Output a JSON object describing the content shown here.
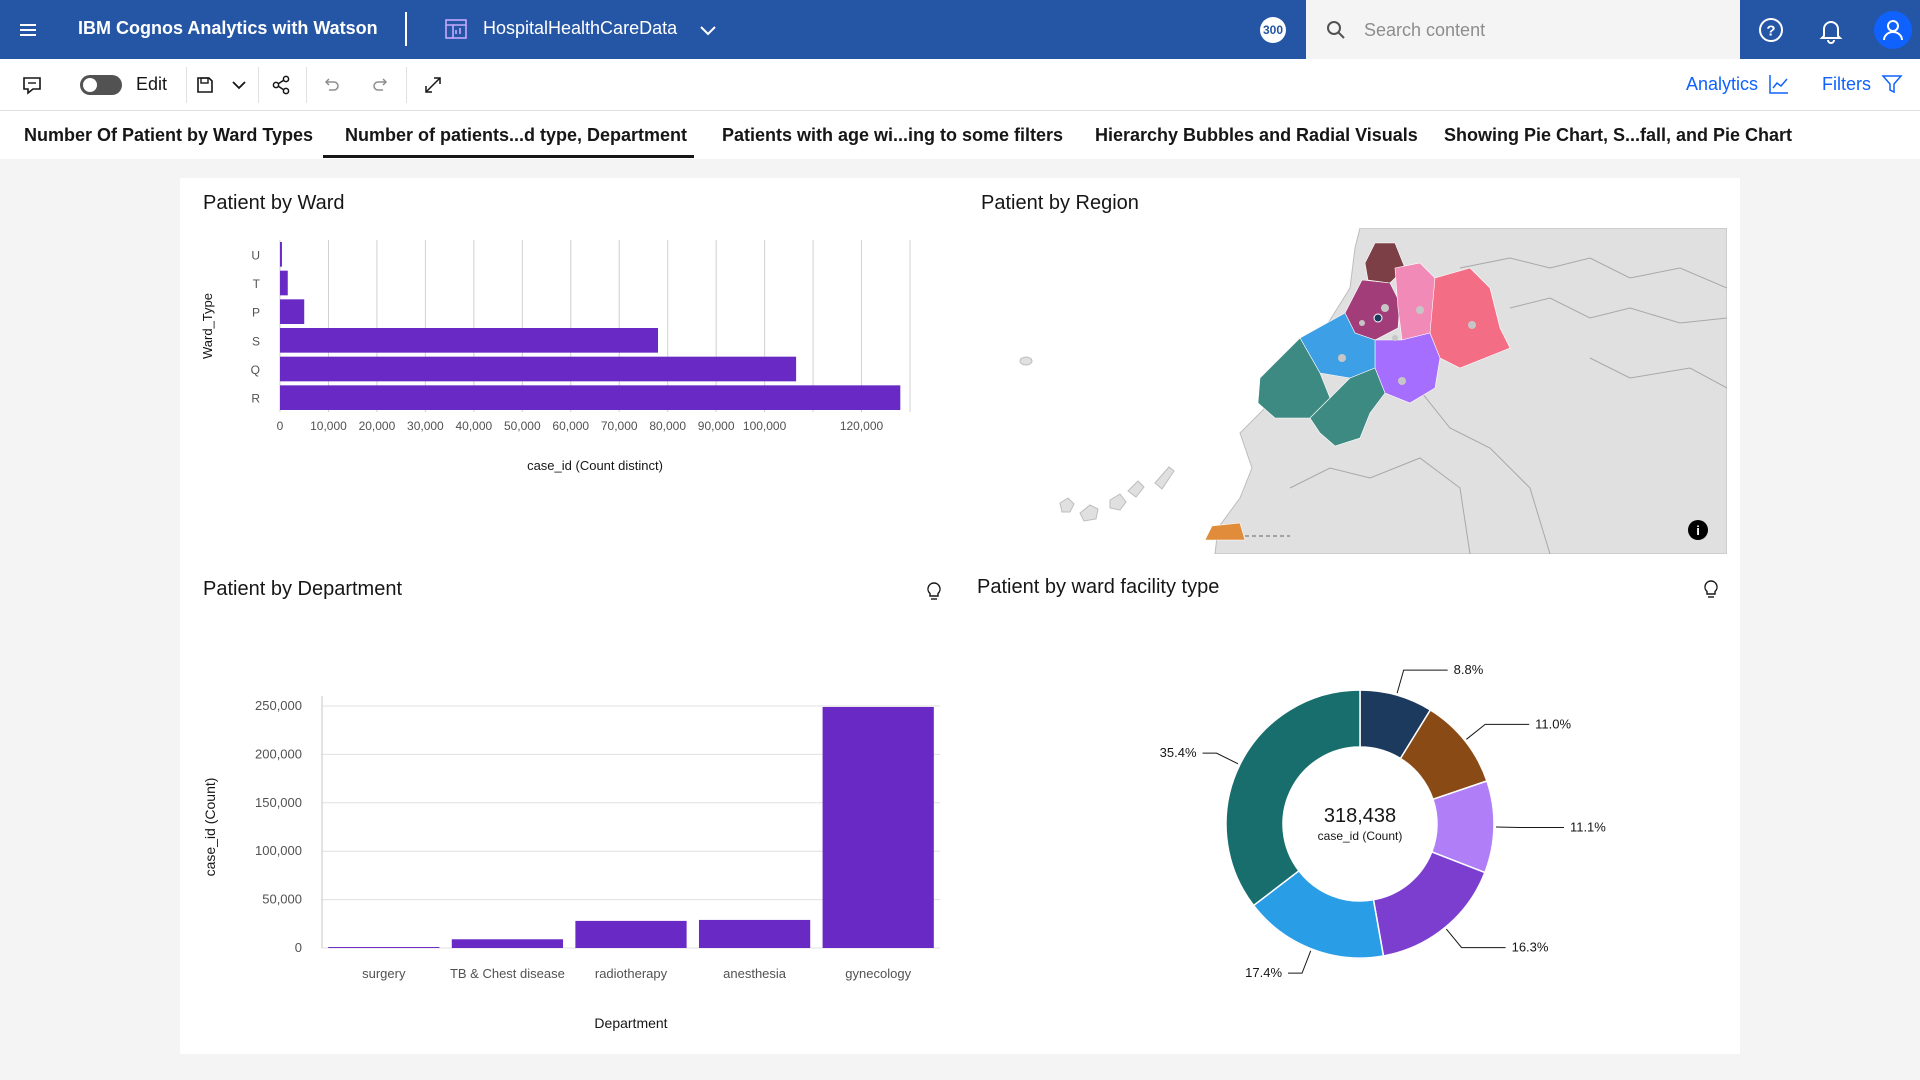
{
  "header": {
    "app_title": "IBM Cognos Analytics with Watson",
    "report_name": "HospitalHealthCareData",
    "counter_badge": "300",
    "search_placeholder": "Search content"
  },
  "toolbar": {
    "edit_label": "Edit",
    "analytics_label": "Analytics",
    "filters_label": "Filters"
  },
  "tabs": [
    {
      "label": "Number Of Patient by Ward Types"
    },
    {
      "label": "Number of patients...d type, Department",
      "active": true
    },
    {
      "label": "Patients with age wi...ing to some filters"
    },
    {
      "label": "Hierarchy Bubbles and Radial Visuals"
    },
    {
      "label": "Showing Pie Chart, S...fall, and Pie Chart"
    }
  ],
  "widgets": {
    "ward": {
      "title": "Patient by Ward"
    },
    "region": {
      "title": "Patient by Region"
    },
    "department": {
      "title": "Patient by Department"
    },
    "facility": {
      "title": "Patient by ward facility type",
      "center_value": "318,438",
      "center_label": "case_id (Count)"
    }
  },
  "chart_data": [
    {
      "type": "bar",
      "orientation": "horizontal",
      "title": "Patient by Ward",
      "categories": [
        "U",
        "T",
        "P",
        "S",
        "Q",
        "R"
      ],
      "values": [
        400,
        1600,
        5000,
        78000,
        106500,
        128000
      ],
      "xlabel": "case_id (Count distinct)",
      "ylabel": "Ward_Type",
      "xticks": [
        "0",
        "10,000",
        "20,000",
        "30,000",
        "40,000",
        "50,000",
        "60,000",
        "70,000",
        "80,000",
        "90,000",
        "100,000",
        "120,000"
      ],
      "xlim": [
        0,
        130000
      ],
      "grid": true,
      "color": "#6929c4"
    },
    {
      "type": "bar",
      "title": "Patient by Department",
      "categories": [
        "surgery",
        "TB & Chest disease",
        "radiotherapy",
        "anesthesia",
        "gynecology"
      ],
      "values": [
        1000,
        9000,
        28000,
        29000,
        249000
      ],
      "xlabel": "Department",
      "ylabel": "case_id (Count)",
      "yticks": [
        "0",
        "50,000",
        "100,000",
        "150,000",
        "200,000",
        "250,000"
      ],
      "ylim": [
        0,
        250000
      ],
      "grid": true,
      "color": "#6929c4"
    },
    {
      "type": "pie",
      "donut": true,
      "title": "Patient by ward facility type",
      "center_value": "318,438",
      "center_label": "case_id (Count)",
      "slices": [
        {
          "value": 8.8,
          "label": "8.8%",
          "color": "#1c3a5e"
        },
        {
          "value": 11.0,
          "label": "11.0%",
          "color": "#8a4a16"
        },
        {
          "value": 11.1,
          "label": "11.1%",
          "color": "#b07ef6"
        },
        {
          "value": 16.3,
          "label": "16.3%",
          "color": "#7c3ecf"
        },
        {
          "value": 17.4,
          "label": "17.4%",
          "color": "#2a9de7"
        },
        {
          "value": 35.4,
          "label": "35.4%",
          "color": "#176e6c"
        }
      ]
    }
  ]
}
